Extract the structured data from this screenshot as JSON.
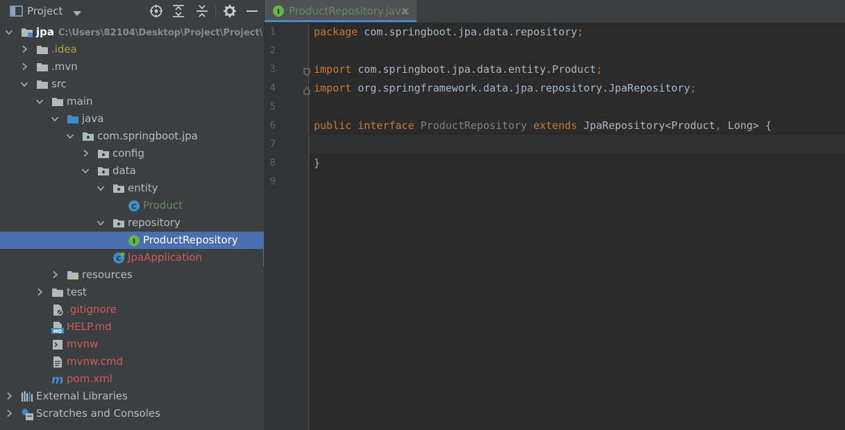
{
  "project_panel": {
    "title": "Project",
    "colors": {
      "background": "#3c3f41",
      "selected_row": "#4b6eaf"
    },
    "toolbar_icons": [
      "locate-icon",
      "expand-all-icon",
      "collapse-all-icon",
      "gear-icon",
      "minimize-icon"
    ]
  },
  "tree": [
    {
      "label": "jpa",
      "hint": "C:\\Users\\82104\\Desktop\\Project\\Project\\",
      "color": "#ffffff",
      "bold": true,
      "depth": 0,
      "arrow": "down",
      "icon": "module-folder-icon"
    },
    {
      "label": ".idea",
      "color": "#a6a43f",
      "depth": 1,
      "arrow": "right",
      "icon": "folder-icon"
    },
    {
      "label": ".mvn",
      "color": "#bbbbbb",
      "depth": 1,
      "arrow": "right",
      "icon": "folder-icon"
    },
    {
      "label": "src",
      "color": "#bbbbbb",
      "depth": 1,
      "arrow": "down",
      "icon": "folder-icon"
    },
    {
      "label": "main",
      "color": "#bbbbbb",
      "depth": 2,
      "arrow": "down",
      "icon": "folder-icon"
    },
    {
      "label": "java",
      "color": "#bbbbbb",
      "depth": 3,
      "arrow": "down",
      "icon": "source-folder-icon"
    },
    {
      "label": "com.springboot.jpa",
      "color": "#bbbbbb",
      "depth": 4,
      "arrow": "down",
      "icon": "package-icon"
    },
    {
      "label": "config",
      "color": "#bbbbbb",
      "depth": 5,
      "arrow": "right",
      "icon": "package-icon"
    },
    {
      "label": "data",
      "color": "#bbbbbb",
      "depth": 5,
      "arrow": "down",
      "icon": "package-icon"
    },
    {
      "label": "entity",
      "color": "#bbbbbb",
      "depth": 6,
      "arrow": "down",
      "icon": "package-icon"
    },
    {
      "label": "Product",
      "color": "#6a8759",
      "depth": 7,
      "arrow": "none",
      "icon": "class-icon"
    },
    {
      "label": "repository",
      "color": "#bbbbbb",
      "depth": 6,
      "arrow": "down",
      "icon": "package-icon"
    },
    {
      "label": "ProductRepository",
      "color": "#ffffff",
      "depth": 7,
      "arrow": "none",
      "icon": "interface-icon",
      "selected": true
    },
    {
      "label": "JpaApplication",
      "color": "#cf5b56",
      "depth": 6,
      "arrow": "none",
      "icon": "spring-boot-class-icon",
      "focused": true
    },
    {
      "label": "resources",
      "color": "#bbbbbb",
      "depth": 3,
      "arrow": "right",
      "icon": "resources-folder-icon"
    },
    {
      "label": "test",
      "color": "#bbbbbb",
      "depth": 2,
      "arrow": "right",
      "icon": "folder-icon"
    },
    {
      "label": ".gitignore",
      "color": "#cf5b56",
      "depth": 2,
      "arrow": "none",
      "icon": "ignore-file-icon"
    },
    {
      "label": "HELP.md",
      "color": "#cf5b56",
      "depth": 2,
      "arrow": "none",
      "icon": "markdown-file-icon"
    },
    {
      "label": "mvnw",
      "color": "#cf5b56",
      "depth": 2,
      "arrow": "none",
      "icon": "shell-script-icon"
    },
    {
      "label": "mvnw.cmd",
      "color": "#cf5b56",
      "depth": 2,
      "arrow": "none",
      "icon": "text-file-icon"
    },
    {
      "label": "pom.xml",
      "color": "#cf5b56",
      "depth": 2,
      "arrow": "none",
      "icon": "maven-icon"
    },
    {
      "label": "External Libraries",
      "color": "#bbbbbb",
      "depth": 0,
      "arrow": "right",
      "icon": "libraries-icon"
    },
    {
      "label": "Scratches and Consoles",
      "color": "#bbbbbb",
      "depth": 0,
      "arrow": "right",
      "icon": "scratches-icon"
    }
  ],
  "editor": {
    "tab_label": "ProductRepository.java",
    "tab_color": "#6a8759",
    "caret_line": 7,
    "colors": {
      "keyword": "#cc7832",
      "text": "#a9b7c6",
      "unused": "#808080",
      "line_number": "#606366"
    },
    "lines": [
      [
        {
          "t": "package ",
          "c": "kw"
        },
        {
          "t": "com.springboot.jpa.data.repository"
        },
        {
          "t": ";",
          "c": "semi"
        }
      ],
      [],
      [
        {
          "t": "import ",
          "c": "kw"
        },
        {
          "t": "com.springboot.jpa.data.entity.Product"
        },
        {
          "t": ";",
          "c": "semi"
        }
      ],
      [
        {
          "t": "import ",
          "c": "kw"
        },
        {
          "t": "org.springframework.data.jpa.repository.JpaRepository"
        },
        {
          "t": ";",
          "c": "semi"
        }
      ],
      [],
      [
        {
          "t": "public ",
          "c": "kw"
        },
        {
          "t": "interface ",
          "c": "kw"
        },
        {
          "t": "ProductRepository ",
          "c": "ifname"
        },
        {
          "t": "extends ",
          "c": "kw"
        },
        {
          "t": "JpaRepository<Product"
        },
        {
          "t": ", ",
          "c": "semi"
        },
        {
          "t": "Long> {"
        }
      ],
      [],
      [
        {
          "t": "}"
        }
      ],
      []
    ]
  }
}
